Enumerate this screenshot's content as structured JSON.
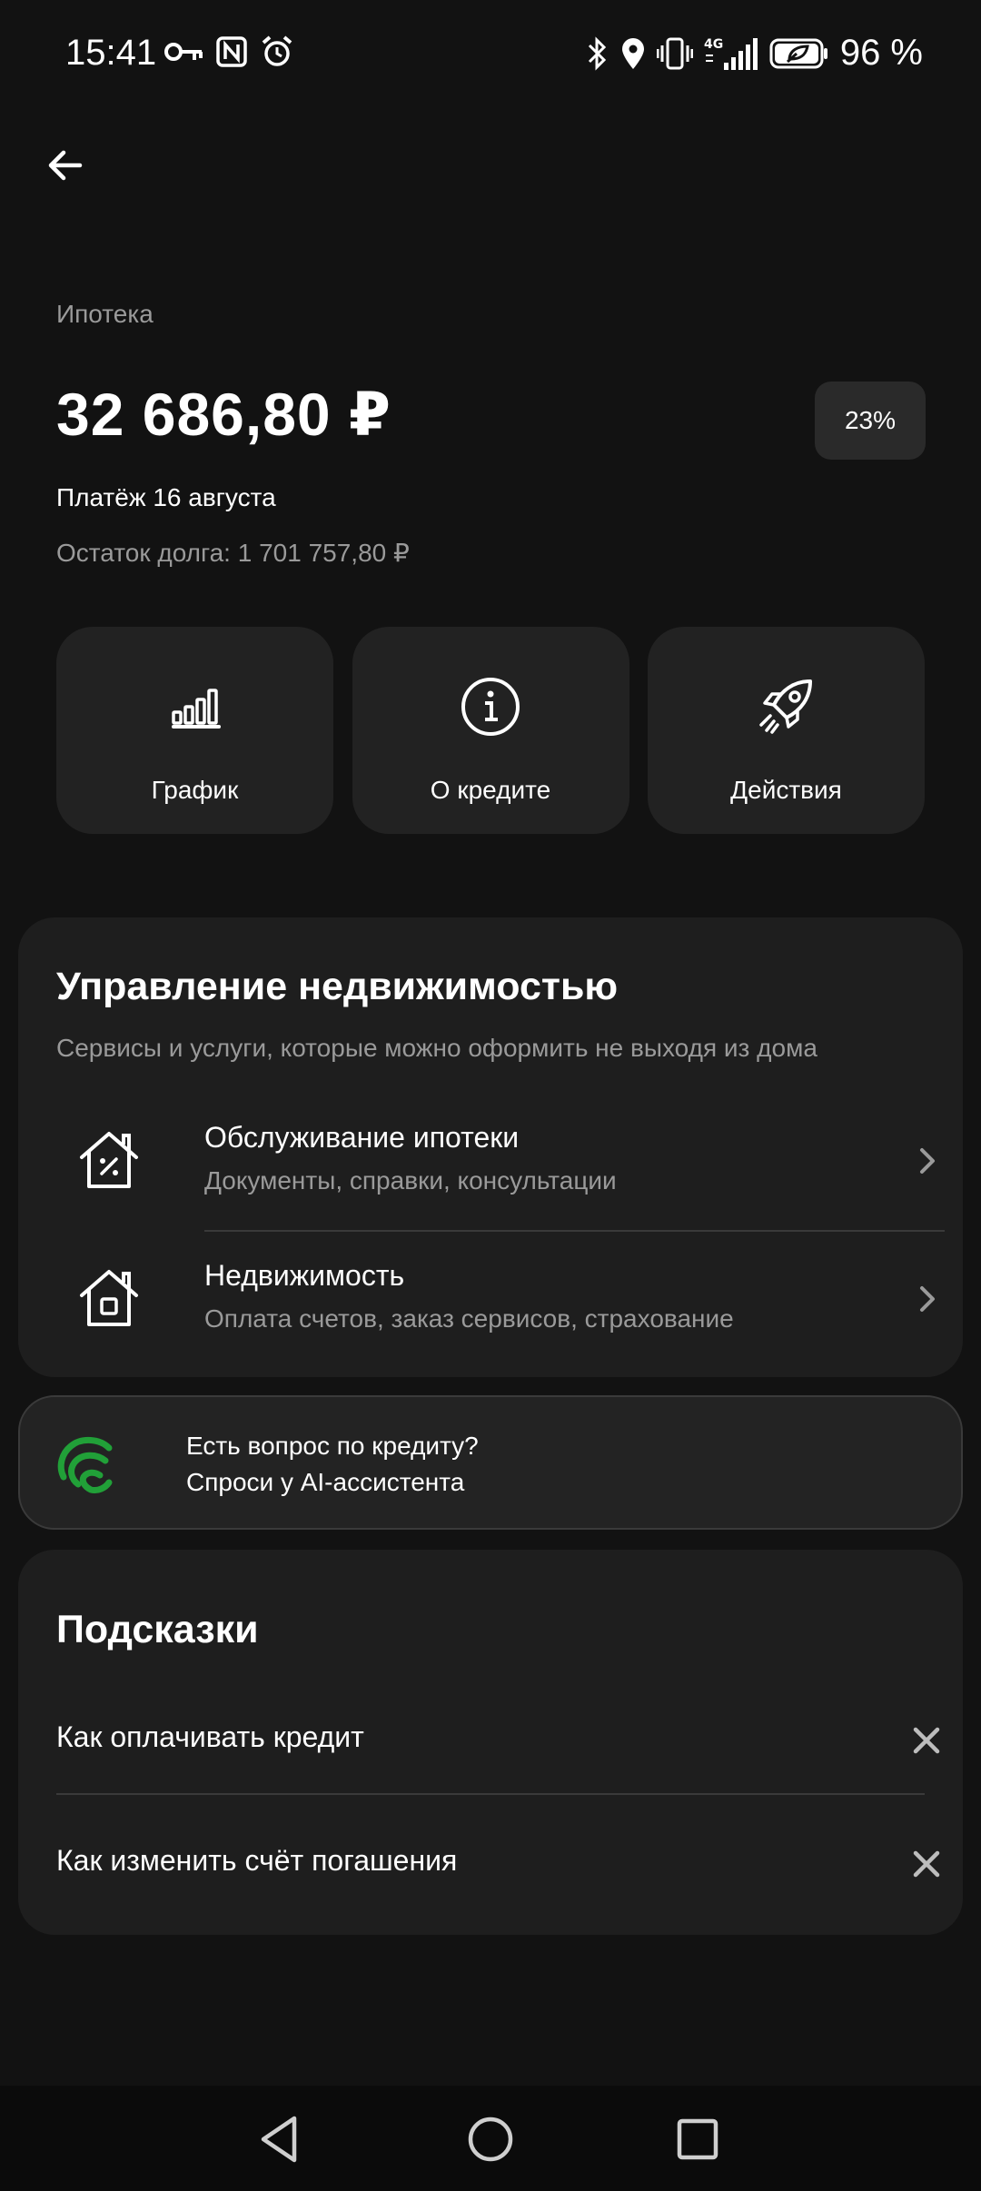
{
  "status_bar": {
    "time": "15:41",
    "battery_text": "96 %",
    "network": "4G",
    "icons_left": [
      "key-icon",
      "nfc-icon",
      "alarm-icon"
    ],
    "icons_right": [
      "bluetooth-icon",
      "location-icon",
      "vibrate-icon",
      "signal-icon",
      "battery-icon"
    ]
  },
  "header": {
    "back_icon": "arrow-left-icon"
  },
  "loan": {
    "type": "Ипотека",
    "amount": "32 686,80 ₽",
    "progress_label": "23%",
    "progress": 0.23,
    "payment_date": "Платёж 16 августа",
    "remaining_debt": "Остаток долга: 1 701 757,80 ₽"
  },
  "actions": [
    {
      "label": "График",
      "icon": "chart-icon"
    },
    {
      "label": "О кредите",
      "icon": "info-icon"
    },
    {
      "label": "Действия",
      "icon": "rocket-icon"
    }
  ],
  "property": {
    "title": "Управление недвижимостью",
    "subtitle": "Сервисы и услуги, которые можно оформить не выходя из дома",
    "items": [
      {
        "title": "Обслуживание ипотеки",
        "subtitle": "Документы, справки, консультации",
        "icon": "house-percent-icon"
      },
      {
        "title": "Недвижимость",
        "subtitle": "Оплата счетов, заказ сервисов, страхование",
        "icon": "house-icon"
      }
    ]
  },
  "ai": {
    "line1": "Есть вопрос по кредиту?",
    "line2": "Спроси у AI-ассистента",
    "accent": "#21a038"
  },
  "tips": {
    "title": "Подсказки",
    "items": [
      {
        "text": "Как оплачивать кредит"
      },
      {
        "text": "Как изменить счёт погашения"
      }
    ]
  },
  "nav": {
    "back": "triangle-back-icon",
    "home": "circle-home-icon",
    "recents": "square-recents-icon"
  }
}
